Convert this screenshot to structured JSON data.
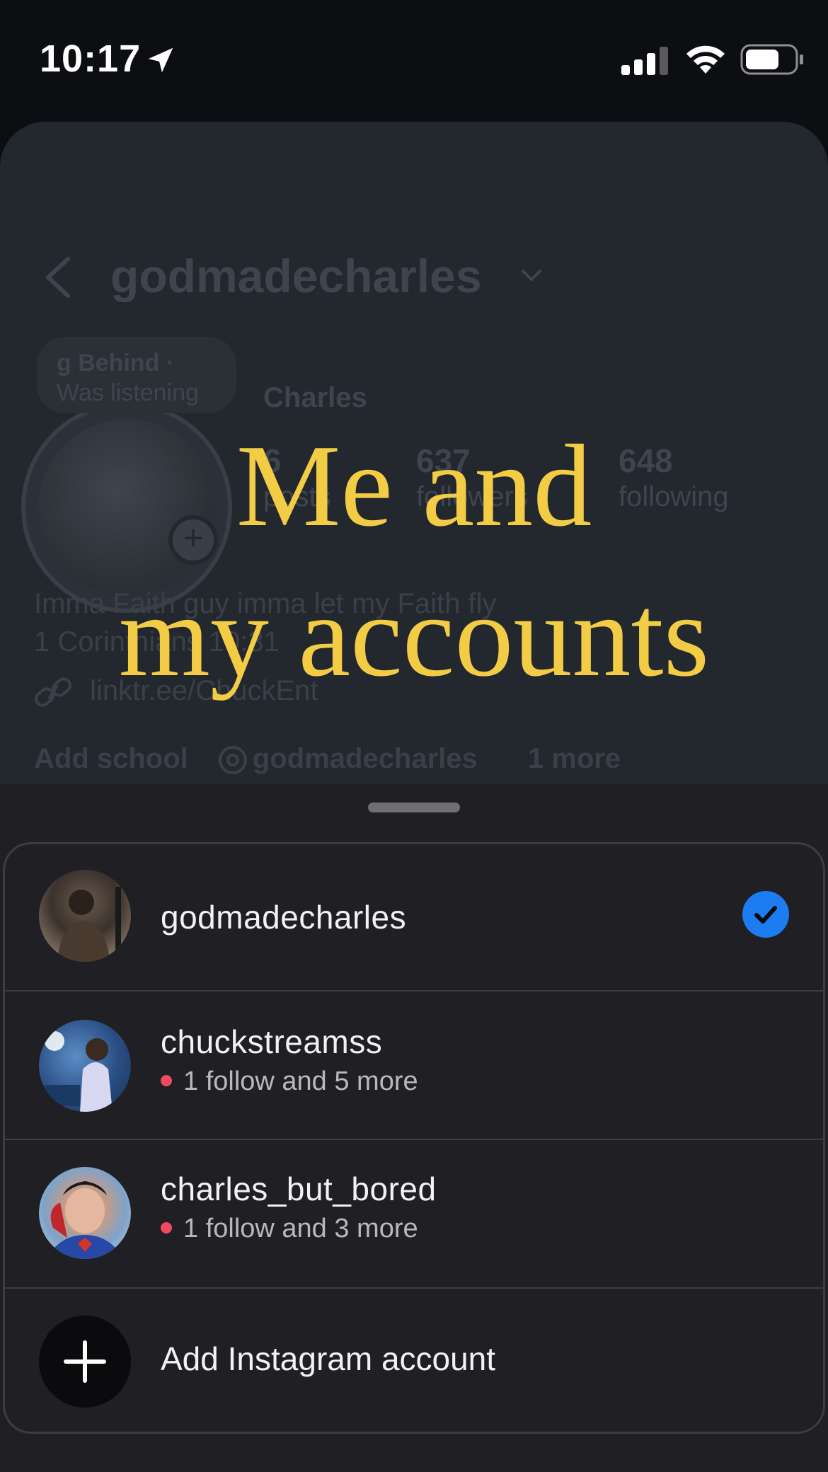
{
  "status_bar": {
    "time": "10:17",
    "icons": [
      "location-arrow-icon",
      "signal-icon",
      "wifi-icon",
      "battery-icon"
    ]
  },
  "profile": {
    "username": "godmadecharles",
    "note_title": "g Behind ·",
    "note_status": "Was listening",
    "display_name": "Charles",
    "stats": [
      {
        "value": "6",
        "label": "posts"
      },
      {
        "value": "637",
        "label": "followers"
      },
      {
        "value": "648",
        "label": "following"
      }
    ],
    "bio_line1": "Imma Faith guy imma let my Faith fly",
    "bio_line2": "1 Corinthians 10:31",
    "link": "linktr.ee/ChuckEnt",
    "add_school": "Add school",
    "threads_handle": "godmadecharles",
    "more": "1 more"
  },
  "caption": {
    "line1": "Me and",
    "line2": "my accounts",
    "color": "#f3cc45"
  },
  "accounts": [
    {
      "username": "godmadecharles",
      "subtitle": "",
      "selected": true
    },
    {
      "username": "chuckstreamss",
      "subtitle": "1 follow and 5 more",
      "selected": false
    },
    {
      "username": "charles_but_bored",
      "subtitle": "1 follow and 3 more",
      "selected": false
    }
  ],
  "add_account_label": "Add Instagram account",
  "colors": {
    "accent_blue": "#1d7cf2",
    "notification_dot": "#f04a60",
    "sheet_bg": "#1f1f24"
  }
}
